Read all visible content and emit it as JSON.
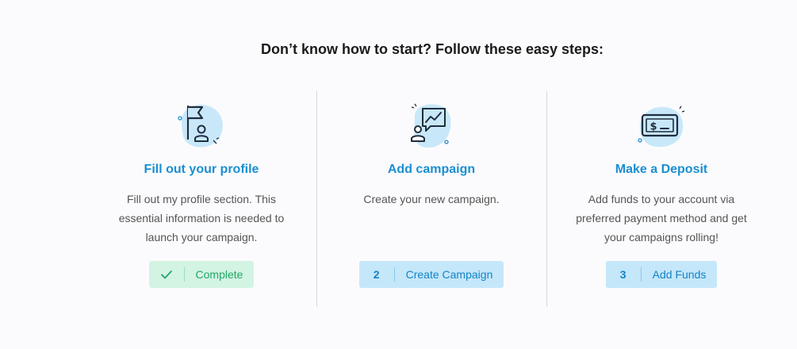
{
  "heading": "Don’t know how to start? Follow these easy steps:",
  "steps": [
    {
      "icon": "flag-profile-icon",
      "title": "Fill out your profile",
      "description": "Fill out my profile section. This essential information is needed to launch your campaign.",
      "button": {
        "number": "",
        "label": "Complete",
        "status": "complete"
      }
    },
    {
      "icon": "campaign-chart-icon",
      "title": "Add campaign",
      "description": "Create your new campaign.",
      "button": {
        "number": "2",
        "label": "Create Campaign",
        "status": "pending"
      }
    },
    {
      "icon": "dollar-card-icon",
      "title": "Make a Deposit",
      "description": "Add funds to your account via preferred payment method and get your campaigns rolling!",
      "button": {
        "number": "3",
        "label": "Add Funds",
        "status": "pending"
      }
    }
  ],
  "colors": {
    "accent": "#1a8fd1",
    "complete": "#20a866",
    "icon_blob": "#c8e8fa",
    "icon_stroke": "#1f2d3d"
  }
}
